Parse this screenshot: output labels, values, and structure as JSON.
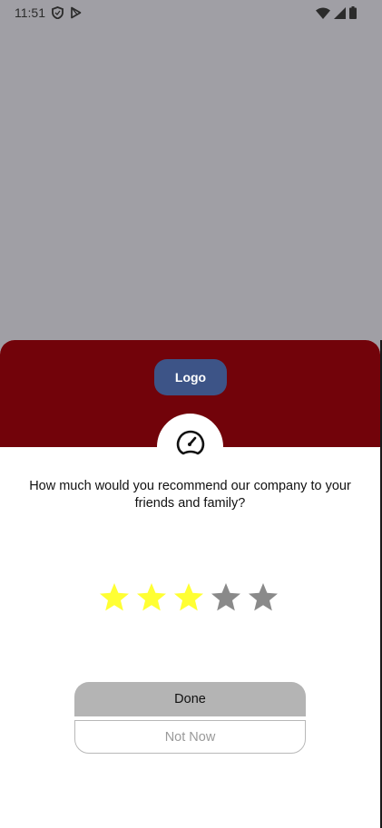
{
  "status_bar": {
    "time": "11:51",
    "left_icons": [
      "shield-icon",
      "play-store-icon"
    ],
    "right_icons": [
      "wifi-icon",
      "cellular-signal-icon",
      "battery-icon"
    ]
  },
  "sheet": {
    "logo_label": "Logo",
    "header_color": "#72030a",
    "logo_color": "#3d5487",
    "badge_icon": "speedometer-icon",
    "question": "How much would you recommend our company to your friends and family?",
    "rating": {
      "value": 3,
      "max": 5,
      "filled_color": "#ffff33",
      "empty_color": "#8a8a8a"
    },
    "done_label": "Done",
    "not_now_label": "Not Now"
  }
}
